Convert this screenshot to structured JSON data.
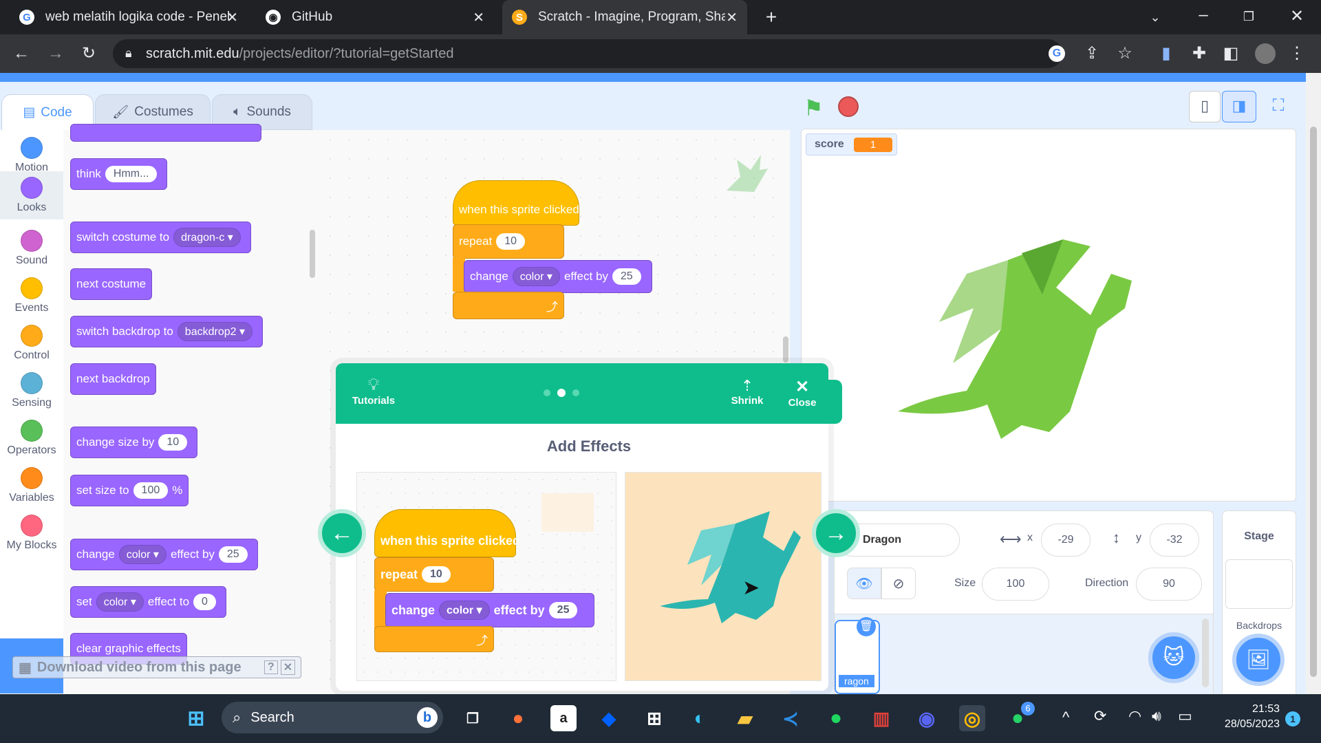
{
  "browser": {
    "tabs": [
      {
        "title": "web melatih logika code - Penelu",
        "icon": "google-icon"
      },
      {
        "title": "GitHub",
        "icon": "github-icon"
      },
      {
        "title": "Scratch - Imagine, Program, Shar",
        "icon": "scratch-icon"
      }
    ],
    "url_domain": "scratch.mit.edu",
    "url_path": "/projects/editor/?tutorial=getStarted"
  },
  "editor_tabs": {
    "code": "Code",
    "costumes": "Costumes",
    "sounds": "Sounds"
  },
  "categories": [
    {
      "label": "Motion",
      "color": "#4c97ff"
    },
    {
      "label": "Looks",
      "color": "#9966ff"
    },
    {
      "label": "Sound",
      "color": "#cf63cf"
    },
    {
      "label": "Events",
      "color": "#ffbf00"
    },
    {
      "label": "Control",
      "color": "#ffab19"
    },
    {
      "label": "Sensing",
      "color": "#5cb1d6"
    },
    {
      "label": "Operators",
      "color": "#59c059"
    },
    {
      "label": "Variables",
      "color": "#ff8c1a"
    },
    {
      "label": "My Blocks",
      "color": "#ff6680"
    }
  ],
  "palette": {
    "think": "think",
    "think_value": "Hmm...",
    "switch_costume": "switch costume to",
    "costume_value": "dragon-c",
    "next_costume": "next costume",
    "switch_backdrop": "switch backdrop to",
    "backdrop_value": "backdrop2",
    "next_backdrop": "next backdrop",
    "change_size": "change size by",
    "change_size_value": "10",
    "set_size": "set size to",
    "set_size_value": "100",
    "percent": "%",
    "change_effect": "change",
    "effect_name": "color",
    "effect_by": "effect by",
    "change_effect_value": "25",
    "set_effect": "set",
    "effect_to": "effect to",
    "set_effect_value": "0",
    "clear_effects": "clear graphic effects"
  },
  "workspace": {
    "hat": "when this sprite clicked",
    "repeat": "repeat",
    "repeat_value": "10",
    "change": "change",
    "effect": "color",
    "effect_by": "effect by",
    "value": "25"
  },
  "download_bar": {
    "label": "Download video from this page",
    "help": "?",
    "close": "✕"
  },
  "stage": {
    "monitor_label": "score",
    "monitor_value": "1"
  },
  "tutorial": {
    "tutorials_label": "Tutorials",
    "shrink_label": "Shrink",
    "close_label": "Close",
    "title": "Add Effects",
    "hat": "when this sprite clicked",
    "repeat": "repeat",
    "repeat_value": "10",
    "change": "change",
    "effect": "color",
    "effect_by": "effect by",
    "value": "25",
    "current_step": 2,
    "total_steps": 3
  },
  "sprite_info": {
    "name": "Dragon",
    "x_label": "x",
    "x": "-29",
    "y_label": "y",
    "y": "-32",
    "size_label": "Size",
    "size": "100",
    "direction_label": "Direction",
    "direction": "90",
    "thumb_label": "ragon"
  },
  "stage_panel": {
    "title": "Stage",
    "backdrops_label": "Backdrops"
  },
  "taskbar": {
    "search_placeholder": "Search",
    "time": "21:53",
    "date": "28/05/2023",
    "whatsapp_badge": "6",
    "notification_count": "1"
  }
}
